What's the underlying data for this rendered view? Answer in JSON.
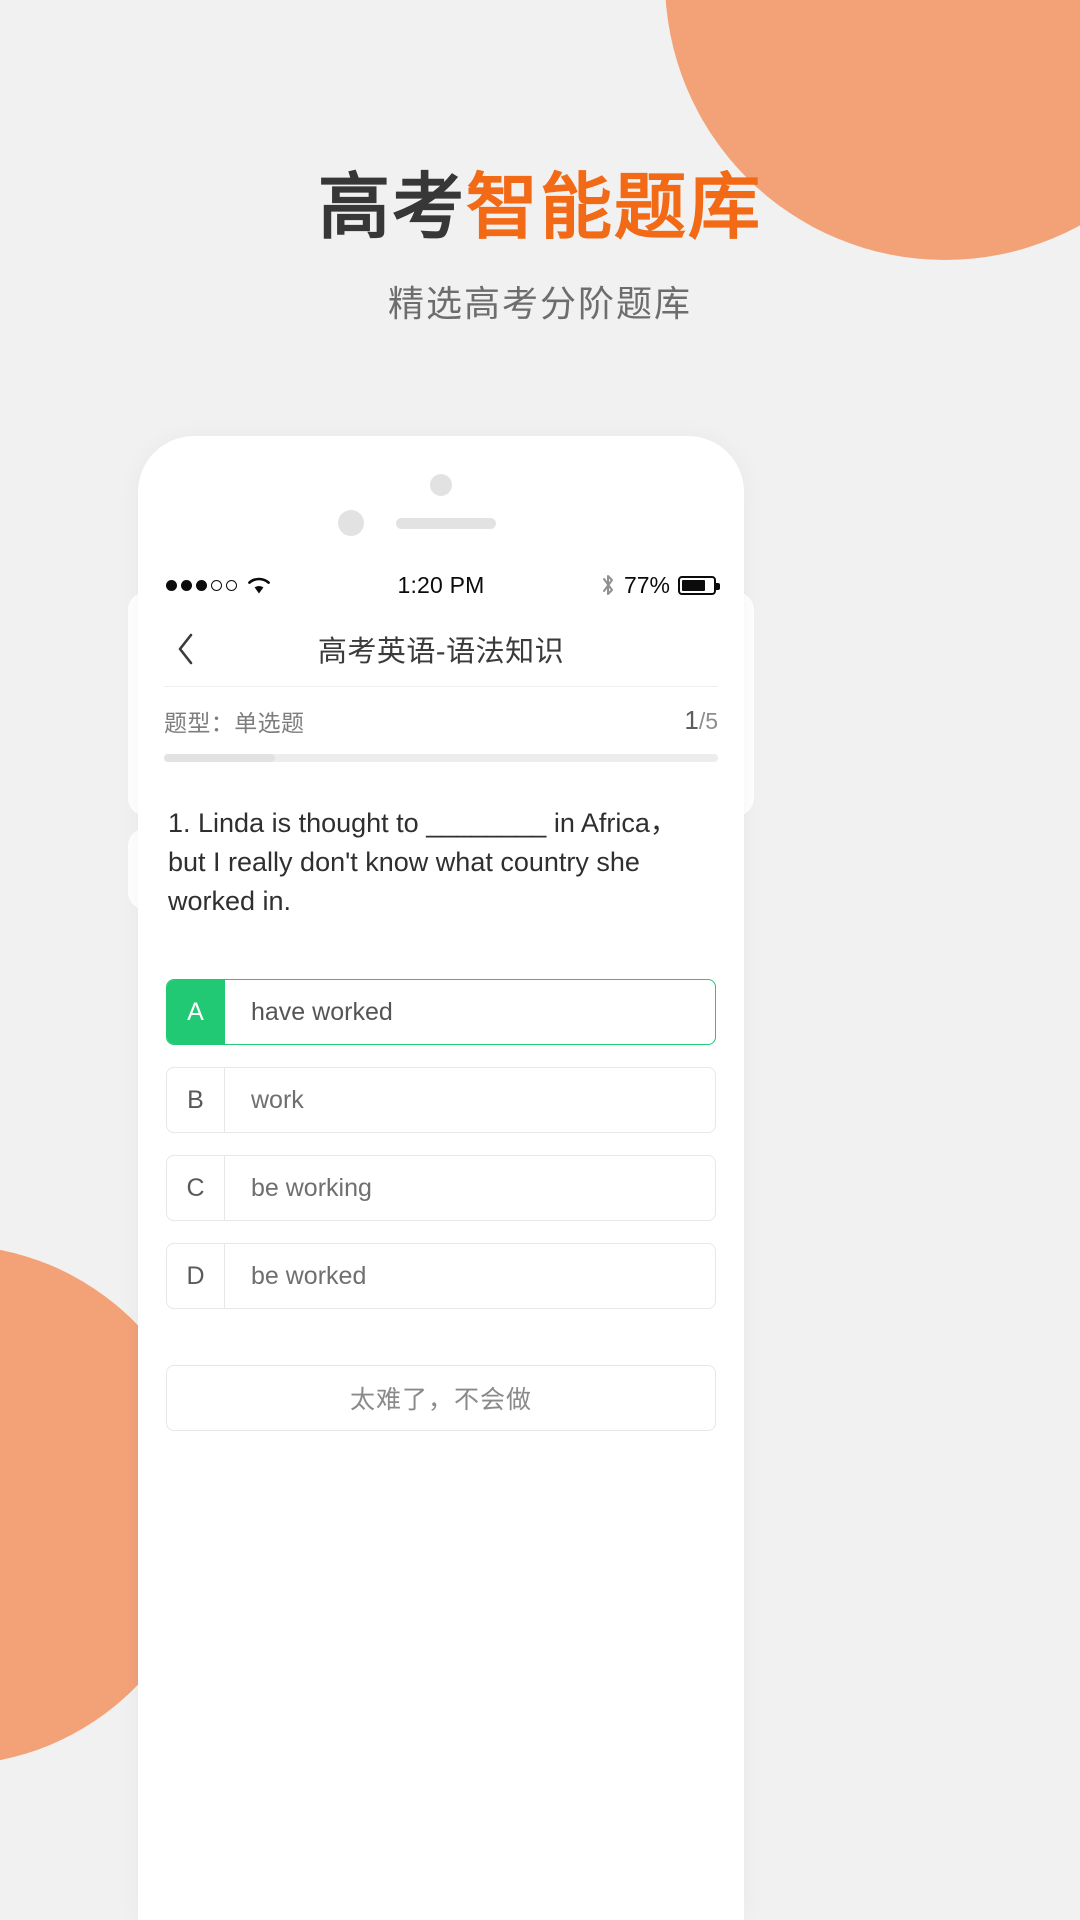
{
  "promo": {
    "title_part_1": "高考",
    "title_part_2": "智能题库",
    "subtitle": "精选高考分阶题库",
    "accent_color": "#f26a16",
    "title_color": "#373737",
    "subtitle_color": "#6d6d6d",
    "blob_color": "#f3a278",
    "background_color": "#f1f1f1"
  },
  "phone": {
    "status_bar": {
      "signal_dots_filled": 3,
      "signal_dots_total": 5,
      "wifi_icon": "wifi-icon",
      "time": "1:20 PM",
      "bluetooth_icon": "bluetooth-icon",
      "battery_percent": "77%",
      "battery_level": 77
    },
    "nav": {
      "back_icon": "chevron-left-icon",
      "title": "高考英语-语法知识"
    },
    "meta": {
      "type_label": "题型：单选题",
      "current_index": "1",
      "total_separator": "/5",
      "progress_percent": 20
    },
    "question": {
      "text": "1. Linda is thought to ________ in Africa，but I really don't know what country she worked in."
    },
    "options": [
      {
        "letter": "A",
        "text": "have worked",
        "selected": true
      },
      {
        "letter": "B",
        "text": "work",
        "selected": false
      },
      {
        "letter": "C",
        "text": "be working",
        "selected": false
      },
      {
        "letter": "D",
        "text": "be worked",
        "selected": false
      }
    ],
    "selected_color": "#22c974",
    "hard_button": {
      "label": "太难了，不会做"
    }
  }
}
